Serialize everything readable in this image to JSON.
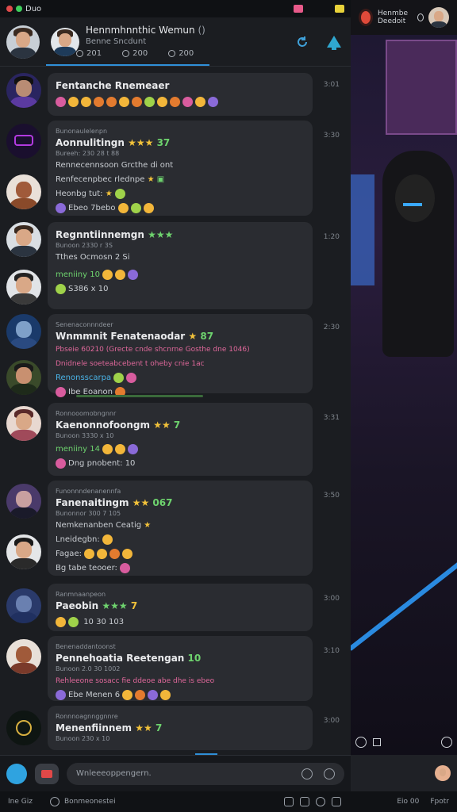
{
  "statusbar": {
    "label": "Duo"
  },
  "header": {
    "title": "Hennmhnnthic Wemun",
    "title_extra": "()",
    "subtitle": "Benne Sncdunt",
    "tabs": [
      {
        "label": "201"
      },
      {
        "label": "200"
      },
      {
        "label": "200"
      }
    ]
  },
  "messages": [
    {
      "name": "Fentanche Rnemeaer",
      "time": "3:01",
      "lines": []
    },
    {
      "name": "Aonnulitingn",
      "rating_text": "37",
      "time": "3:30",
      "small": "Bunonaulelenpn",
      "lines": [
        "Bureeh: 230 28 t 88",
        "Rennecennsoon Grcthe di ont",
        "Renfecenpbec rlednpe",
        "Heonbg tut:",
        "Ebeo 7bebo"
      ]
    },
    {
      "name": "Regnntiinnemgn",
      "time": "1:20",
      "lines": [
        "Bunoon 2330 r 3S",
        "Tthes Ocmosn 2 Si",
        "meniiny 10",
        "S386 x 10"
      ]
    },
    {
      "name": "Wnmmnit Fenatenaodar",
      "rating_text": "87",
      "time": "2:30",
      "small": "Senenaconnndeer",
      "lines": [
        "Pbseie 60210 (Grecte cnde shcnrne Gosthe dne 1046)",
        "Dnidnele soeteabcebent t oheby cnie 1ac",
        "Renonsscarpa",
        "Ibe Eoanon"
      ]
    },
    {
      "name": "Kaenonnofoongm",
      "rating_text": "7",
      "time": "3:31",
      "small": "Ronnooomobngnnr",
      "lines": [
        "Bunoon 3330 x 10",
        "meniiny 14",
        "Dng pnobent:",
        "10"
      ]
    },
    {
      "name": "Fanenaitingm",
      "rating_text": "067",
      "time": "3:50",
      "small": "Funonnndenanennfa",
      "lines": [
        "Bunonnor 300 7 105",
        "Nemkenanben Ceatig",
        "Lneidegbn:",
        "Fagae:",
        "Bg tabe teooer:"
      ]
    },
    {
      "name": "Paeobin",
      "rating_text": "7",
      "time": "3:00",
      "small": "Ranmnaanpeon",
      "lines": [
        "10 30",
        "103"
      ]
    },
    {
      "name": "Pennehoatia Reetengan",
      "rating_text": "10",
      "time": "3:10",
      "small": "Benenaddantoonst",
      "lines": [
        "Bunoon 2.0 30 1002",
        "Rehleeone sosacc fie ddeoe abe dhe is ebeo",
        "Ebe Menen 6"
      ]
    },
    {
      "name": "Menenfiinnem",
      "rating_text": "7",
      "time": "3:00",
      "small": "Ronnnoagnnggnnre",
      "lines": [
        "Bunoon 230 x 10"
      ]
    }
  ],
  "input": {
    "placeholder": "Wnleeeoppengern."
  },
  "bottom": {
    "left": "Ine Giz",
    "center": "Bonmeonestei",
    "r1": "Eio 00",
    "r2": "Fpotr"
  },
  "video": {
    "title": "Henmbe",
    "sub": "Deedoit"
  },
  "colors": {
    "accent": "#2f8fd8",
    "green": "#6ed36e",
    "pink": "#e0689b",
    "star": "#f2c23a"
  }
}
